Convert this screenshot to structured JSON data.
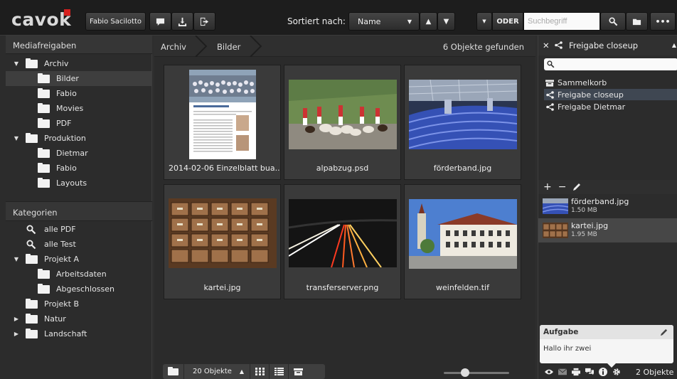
{
  "app": {
    "logo": "cavok",
    "user": "Fabio Sacilotto"
  },
  "toolbar": {
    "sort_label": "Sortiert nach:",
    "sort_value": "Name",
    "oder": "ODER",
    "search_placeholder": "Suchbegriff"
  },
  "left": {
    "media_title": "Mediafreigaben",
    "media": [
      {
        "label": "Archiv",
        "level": 0,
        "arrow": "▼"
      },
      {
        "label": "Bilder",
        "level": 1,
        "selected": true
      },
      {
        "label": "Fabio",
        "level": 1
      },
      {
        "label": "Movies",
        "level": 1
      },
      {
        "label": "PDF",
        "level": 1
      },
      {
        "label": "Produktion",
        "level": 0,
        "arrow": "▼"
      },
      {
        "label": "Dietmar",
        "level": 1
      },
      {
        "label": "Fabio",
        "level": 1
      },
      {
        "label": "Layouts",
        "level": 1
      }
    ],
    "cat_title": "Kategorien",
    "categories": [
      {
        "label": "alle PDF",
        "icon": "search"
      },
      {
        "label": "alle Test",
        "icon": "search"
      },
      {
        "label": "Projekt A",
        "icon": "folder",
        "arrow": "▼"
      },
      {
        "label": "Arbeitsdaten",
        "icon": "folder",
        "level": 1
      },
      {
        "label": "Abgeschlossen",
        "icon": "folder",
        "level": 1
      },
      {
        "label": "Projekt B",
        "icon": "folder"
      },
      {
        "label": "Natur",
        "icon": "folder",
        "arrow": "▶"
      },
      {
        "label": "Landschaft",
        "icon": "folder",
        "arrow": "▶"
      }
    ]
  },
  "main": {
    "crumbs": [
      "Archiv",
      "Bilder"
    ],
    "found": "6 Objekte gefunden",
    "items": [
      {
        "name": "2014-02-06 Einzelblatt bua...",
        "kind": "document"
      },
      {
        "name": "alpabzug.psd",
        "kind": "parade"
      },
      {
        "name": "förderband.jpg",
        "kind": "conveyor"
      },
      {
        "name": "kartei.jpg",
        "kind": "drawers"
      },
      {
        "name": "transferserver.png",
        "kind": "lights"
      },
      {
        "name": "weinfelden.tif",
        "kind": "town"
      }
    ],
    "bottom": {
      "count": "20 Objekte"
    }
  },
  "right": {
    "header": "Freigabe closeup",
    "shares": [
      {
        "label": "Sammelkorb",
        "icon": "basket"
      },
      {
        "label": "Freigabe closeup",
        "icon": "share",
        "selected": true
      },
      {
        "label": "Freigabe Dietmar",
        "icon": "share"
      }
    ],
    "files": [
      {
        "name": "förderband.jpg",
        "size": "1.50 MB"
      },
      {
        "name": "kartei.jpg",
        "size": "1.95 MB",
        "selected": true
      }
    ],
    "task": {
      "title": "Aufgabe",
      "text": "Hallo ihr zwei"
    },
    "footer_count": "2 Objekte"
  },
  "colors": {
    "accent": "#d6201f",
    "selection": "#3f4752"
  }
}
